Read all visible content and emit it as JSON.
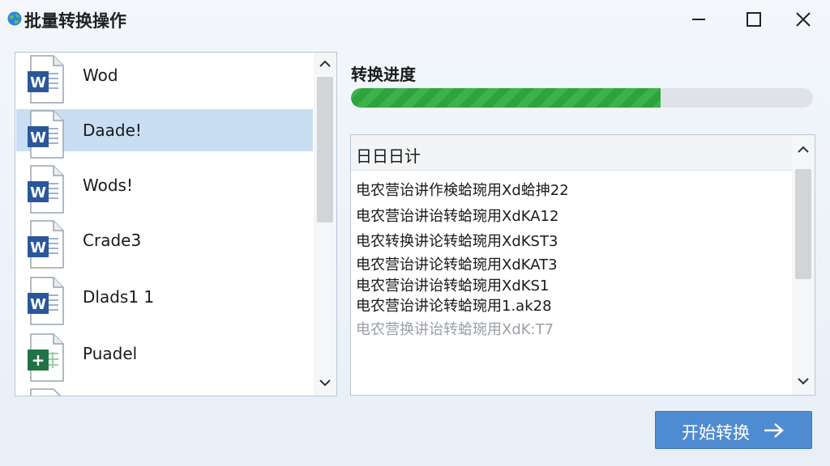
{
  "window": {
    "title": "批量转换操作",
    "icons": {
      "app": "globe-icon",
      "minimize": "minimize-icon",
      "maximize": "maximize-icon",
      "close": "close-icon"
    }
  },
  "file_list": {
    "items": [
      {
        "name": "Wod",
        "icon": "word-doc-icon",
        "selected": false
      },
      {
        "name": "Daade!",
        "icon": "word-doc-icon",
        "selected": true
      },
      {
        "name": "Wods!",
        "icon": "word-doc-icon",
        "selected": false
      },
      {
        "name": "Crade3",
        "icon": "word-doc-icon",
        "selected": false
      },
      {
        "name": "Dlads1 1",
        "icon": "word-doc-icon",
        "selected": false
      },
      {
        "name": "Puadel",
        "icon": "excel-sheet-icon",
        "selected": false
      }
    ]
  },
  "progress": {
    "label": "转换进度",
    "fraction": 0.67
  },
  "log": {
    "header": "日日日计",
    "lines": [
      "电农营诒讲作検蛤琬用Xd蛤抻22",
      "电农营诒讲诒转蛤琬用XdKA12",
      "电农转换讲论转蛤琬用XdKST3",
      "电农营诒讲论转蛤琬用XdKAT3",
      "电农营诒讲诒转蛤琬用XdKS1",
      "电农营诒讲论转蛤琬用1.ak28",
      "电农营换讲诒转蛤琬用XdK:T7"
    ]
  },
  "actions": {
    "start_label": "开始转换",
    "start_icon": "arrow-right-icon"
  },
  "colors": {
    "accent": "#4f8bd1",
    "progress": "#3cb24a",
    "selection": "#c9def2"
  }
}
